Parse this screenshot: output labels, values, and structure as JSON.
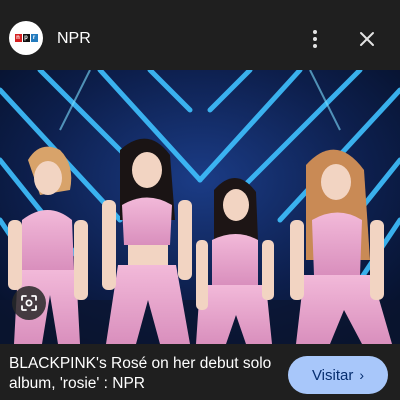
{
  "header": {
    "source_logo_text": "NPR",
    "source_name": "NPR",
    "more_icon": "more-vert-icon",
    "close_icon": "close-icon"
  },
  "image": {
    "lens_icon": "lens-icon"
  },
  "result": {
    "title": "BLACKPINK's Rosé on her debut solo album, 'rosie' : NPR",
    "visit_label": "Visitar",
    "visit_chevron": "›"
  }
}
